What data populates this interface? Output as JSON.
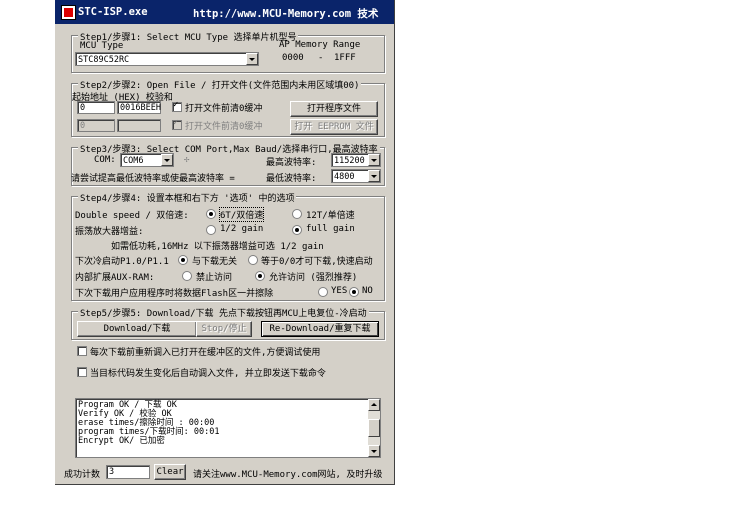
{
  "window": {
    "title": "STC-ISP.exe",
    "url_text": "http://www.MCU-Memory.com 技术"
  },
  "step1": {
    "legend": "Step1/步骤1: Select MCU Type  选择单片机型号",
    "mcu_type_label": "MCU Type",
    "ap_memory_label": "AP Memory Range",
    "mcu_selected": "STC89C52RC",
    "range_start": "0000",
    "range_dash": "-",
    "range_end": "1FFF"
  },
  "step2": {
    "legend": "Step2/步骤2: Open File / 打开文件(文件范围内未用区域填00)",
    "addr_label": "起始地址 (HEX) 校验和",
    "start_addr": "0",
    "checksum": "0016BEEH",
    "clear_buffer_label": "打开文件前清0缓冲",
    "open_file_button": "打开程序文件",
    "eeprom_addr": "0",
    "eeprom_checksum": "",
    "eeprom_clear_label": "打开文件前清0缓冲",
    "open_eeprom_button": "打开 EEPROM 文件"
  },
  "step3": {
    "legend": "Step3/步骤3: Select COM Port,Max Baud/选择串行口,最高波特率",
    "com_label": "COM:",
    "com_value": "COM6",
    "max_baud_label": "最高波特率:",
    "max_baud_value": "115200",
    "retry_label": "请尝试提高最低波特率或使最高波特率 =",
    "min_baud_label": "最低波特率:",
    "min_baud_value": "4800"
  },
  "step4": {
    "legend": "Step4/步骤4: 设置本框和右下方 '选项' 中的选项",
    "double_speed_label": "Double speed / 双倍速:",
    "opt_6t": "6T/双倍速",
    "opt_12t": "12T/单倍速",
    "osc_gain_label": "振荡放大器增益:",
    "opt_half_gain": "1/2 gain",
    "opt_full_gain": "full gain",
    "gain_note": "如需低功耗,16MHz 以下振荡器增益可选 1/2 gain",
    "p1_label": "下次冷启动P1.0/P1.1",
    "opt_p1_free": "与下载无关",
    "opt_p1_zero": "等于0/0才可下载,快速启动",
    "auxram_label": "内部扩展AUX-RAM:",
    "opt_aux_disable": "禁止访问",
    "opt_aux_enable": "允许访问 (强烈推荐)",
    "erase_flash_label": "下次下载用户应用程序时将数据Flash区一并擦除",
    "opt_yes": "YES",
    "opt_no": "NO"
  },
  "step5": {
    "legend": "Step5/步骤5: Download/下载  先点下载按钮再MCU上电复位-冷启动",
    "download_button": "Download/下载",
    "stop_button": "Stop/停止",
    "redownload_button": "Re-Download/重复下载"
  },
  "options": {
    "reload_before_download": "每次下载前重新调入已打开在缓冲区的文件,方便调试使用",
    "auto_reload": "当目标代码发生变化后自动调入文件, 并立即发送下载命令"
  },
  "log": {
    "lines": [
      "Program OK / 下载 OK",
      "Verify  OK / 校验 OK",
      "erase times/擦除时间 :   00:00",
      "program times/下载时间: 00:01",
      "Encrypt OK/ 已加密"
    ]
  },
  "footer": {
    "success_label": "成功计数",
    "success_count": "3",
    "clear_button": "Clear",
    "follow_text": "请关注www.MCU-Memory.com网站, 及时升级"
  },
  "colors": {
    "titlebar": "#0a246a",
    "face": "#d4d0c8"
  }
}
